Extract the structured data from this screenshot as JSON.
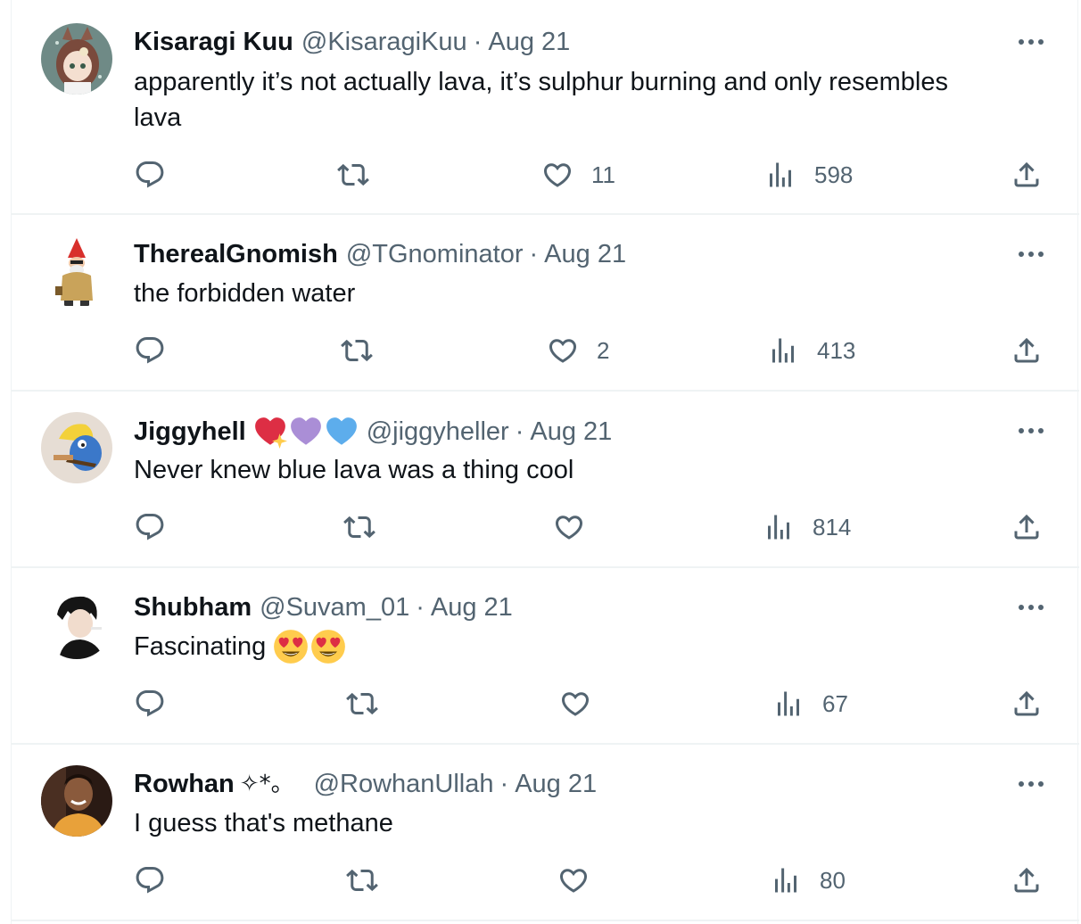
{
  "icons": {
    "reply": "reply-icon",
    "retweet": "retweet-icon",
    "like": "heart-icon",
    "views": "views-icon",
    "share": "share-icon",
    "more": "more-icon"
  },
  "colors": {
    "text_primary": "#0f1419",
    "text_secondary": "#536471",
    "divider": "#eff3f4"
  },
  "tweets": [
    {
      "name": "Kisaragi Kuu",
      "handle": "@KisaragiKuu",
      "dot": "·",
      "date": "Aug 21",
      "text_line1": "apparently it’s not actually lava, it’s sulphur burning and only resembles",
      "text_line2": "lava",
      "likes": "11",
      "views": "598"
    },
    {
      "name": "TherealGnomish",
      "handle": "@TGnominator",
      "dot": "·",
      "date": "Aug 21",
      "text": "the forbidden water",
      "likes": "2",
      "views": "413"
    },
    {
      "name": "Jiggyhell",
      "handle": "@jiggyheller",
      "dot": "·",
      "date": "Aug 21",
      "text": "Never knew blue lava was a thing cool",
      "likes": "",
      "views": "814"
    },
    {
      "name": "Shubham",
      "handle": "@Suvam_01",
      "dot": "·",
      "date": "Aug 21",
      "text": "Fascinating",
      "likes": "",
      "views": "67"
    },
    {
      "name": "Rowhan",
      "name_suffix": "✧*。",
      "handle": "@RowhanUllah",
      "dot": "·",
      "date": "Aug 21",
      "text": "I guess that's methane",
      "likes": "",
      "views": "80"
    }
  ]
}
